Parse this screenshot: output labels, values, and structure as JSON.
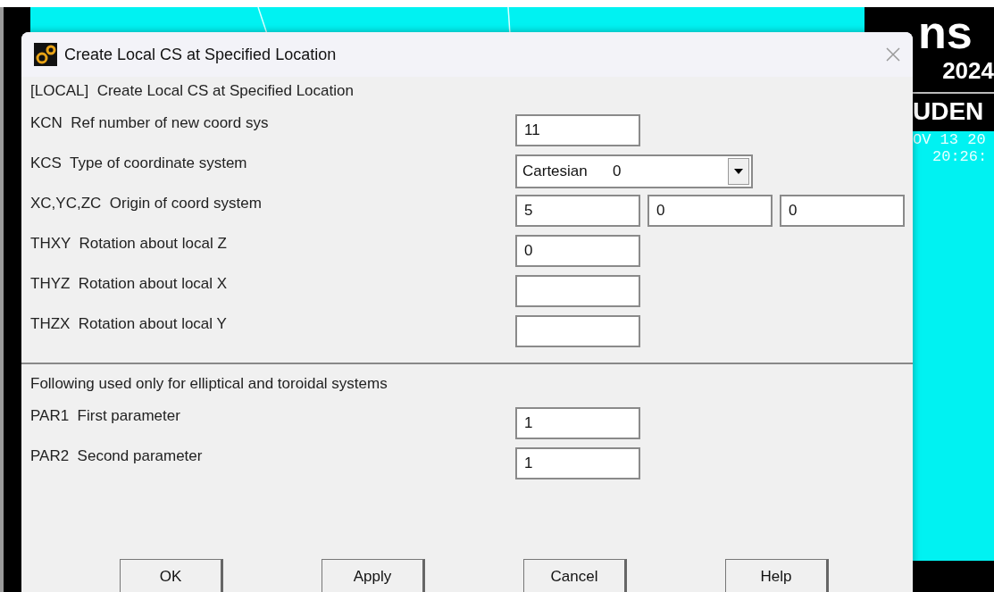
{
  "background": {
    "logo": "ns",
    "year": "2024",
    "edition": "UDEN",
    "date": "OV 13 20",
    "time": "20:26:"
  },
  "dialog": {
    "title": "Create Local CS at Specified Location",
    "heading": "[LOCAL]  Create Local CS at Specified Location",
    "rows": [
      {
        "label": "KCN  Ref number of new coord sys",
        "kind": "fields",
        "values": [
          "11"
        ]
      },
      {
        "label": "KCS  Type of coordinate system",
        "kind": "select",
        "option": "Cartesian",
        "code": "0"
      },
      {
        "label": "XC,YC,ZC  Origin of coord system",
        "kind": "fields",
        "values": [
          "5",
          "0",
          "0"
        ]
      },
      {
        "label": "THXY  Rotation about local Z",
        "kind": "fields",
        "values": [
          "0"
        ]
      },
      {
        "label": "THYZ  Rotation about local X",
        "kind": "blank"
      },
      {
        "label": "THZX  Rotation about local Y",
        "kind": "blank"
      }
    ],
    "note": "Following used only for elliptical and toroidal systems",
    "rows2": [
      {
        "label": "PAR1  First parameter",
        "kind": "fields",
        "values": [
          "1"
        ]
      },
      {
        "label": "PAR2  Second parameter",
        "kind": "fields",
        "values": [
          "1"
        ]
      }
    ],
    "buttons": [
      "OK",
      "Apply",
      "Cancel",
      "Help"
    ]
  }
}
